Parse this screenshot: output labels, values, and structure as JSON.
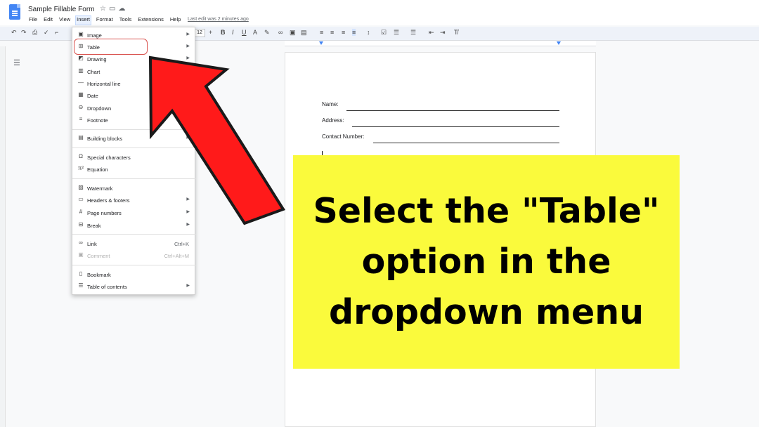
{
  "doc": {
    "title": "Sample Fillable Form",
    "last_edit": "Last edit was 2 minutes ago"
  },
  "menubar": [
    "File",
    "Edit",
    "View",
    "Insert",
    "Format",
    "Tools",
    "Extensions",
    "Help"
  ],
  "toolbar": {
    "font_size": "12"
  },
  "insert_menu": {
    "image": "Image",
    "table": "Table",
    "drawing": "Drawing",
    "chart": "Chart",
    "horizontal_line": "Horizontal line",
    "date": "Date",
    "dropdown": "Dropdown",
    "footnote": "Footnote",
    "building_blocks": "Building blocks",
    "special_characters": "Special characters",
    "equation": "Equation",
    "watermark": "Watermark",
    "headers_footers": "Headers & footers",
    "page_numbers": "Page numbers",
    "break": "Break",
    "link": "Link",
    "link_shortcut": "Ctrl+K",
    "comment": "Comment",
    "comment_shortcut": "Ctrl+Alt+M",
    "bookmark": "Bookmark",
    "table_of_contents": "Table of contents"
  },
  "form": {
    "name_label": "Name:",
    "address_label": "Address:",
    "contact_label": "Contact Number:"
  },
  "callout": {
    "text": "Select the \"Table\" option in the dropdown menu"
  },
  "colors": {
    "accent": "#4285f4",
    "callout_bg": "#fafa3c",
    "arrow": "#ff1a1a",
    "highlight": "#d9534f"
  }
}
